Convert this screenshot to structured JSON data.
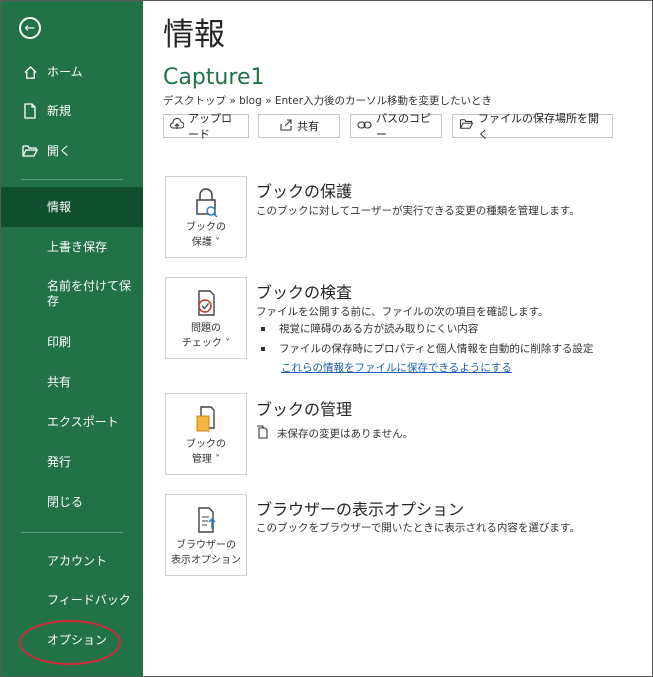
{
  "sidebar": {
    "items": [
      {
        "label": "ホーム"
      },
      {
        "label": "新規"
      },
      {
        "label": "開く"
      },
      {
        "label": "情報"
      },
      {
        "label": "上書き保存"
      },
      {
        "label": "名前を付けて保存"
      },
      {
        "label": "印刷"
      },
      {
        "label": "共有"
      },
      {
        "label": "エクスポート"
      },
      {
        "label": "発行"
      },
      {
        "label": "閉じる"
      },
      {
        "label": "アカウント"
      },
      {
        "label": "フィードバック"
      },
      {
        "label": "オプション"
      }
    ],
    "accent": "#217346",
    "active_bg": "#0f4f2c",
    "highlight_color": "#d2283a"
  },
  "main": {
    "page_title": "情報",
    "doc_title": "Capture1",
    "path": "デスクトップ » blog » Enter入力後のカーソル移動を変更したいとき",
    "buttons": {
      "upload": "アップロード",
      "share": "共有",
      "copy_path": "パスのコピー",
      "open_location": "ファイルの保存場所を開く"
    },
    "sections": {
      "protect": {
        "card_line1": "ブックの",
        "card_line2": "保護 ˅",
        "title": "ブックの保護",
        "desc": "このブックに対してユーザーが実行できる変更の種類を管理します。"
      },
      "inspect": {
        "card_line1": "問題の",
        "card_line2": "チェック ˅",
        "title": "ブックの検査",
        "desc": "ファイルを公開する前に、ファイルの次の項目を確認します。",
        "bullet1": "視覚に障碍のある方が読み取りにくい内容",
        "bullet2": "ファイルの保存時にプロパティと個人情報を自動的に削除する設定",
        "link": "これらの情報をファイルに保存できるようにする"
      },
      "manage": {
        "card_line1": "ブックの",
        "card_line2": "管理 ˅",
        "title": "ブックの管理",
        "status": "未保存の変更はありません。"
      },
      "browser": {
        "card_line1": "ブラウザーの",
        "card_line2": "表示オプション",
        "title": "ブラウザーの表示オプション",
        "desc": "このブックをブラウザーで開いたときに表示される内容を選びます。"
      }
    }
  }
}
